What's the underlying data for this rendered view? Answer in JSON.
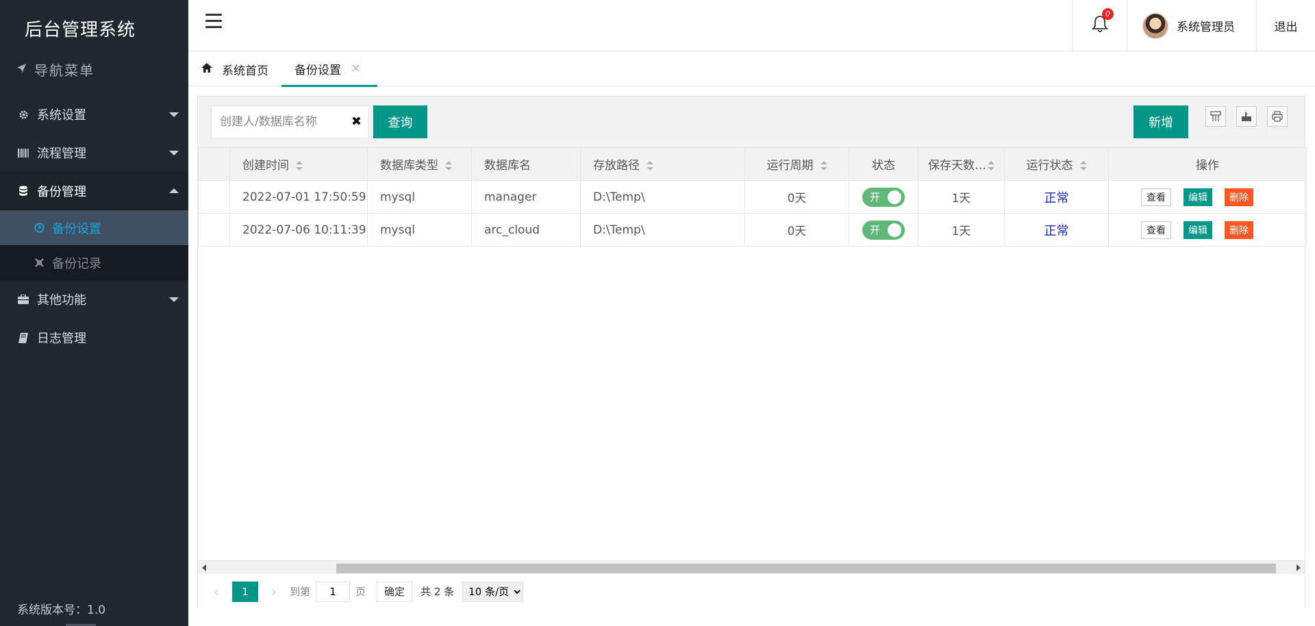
{
  "app": {
    "title": "后台管理系统",
    "nav_menu_label": "导航菜单",
    "version_label": "系统版本号：1.0"
  },
  "sidebar": {
    "items": [
      {
        "label": "系统设置",
        "icon": "gear-icon",
        "expanded": false
      },
      {
        "label": "流程管理",
        "icon": "barcode-icon",
        "expanded": false
      },
      {
        "label": "备份管理",
        "icon": "database-icon",
        "expanded": true,
        "children": [
          {
            "label": "备份设置",
            "icon": "clock-icon",
            "active": true
          },
          {
            "label": "备份记录",
            "icon": "cross-icon",
            "active": false
          }
        ]
      },
      {
        "label": "其他功能",
        "icon": "briefcase-icon",
        "expanded": false
      },
      {
        "label": "日志管理",
        "icon": "book-icon",
        "expanded": false
      }
    ]
  },
  "header": {
    "notification_count": "0",
    "user_name": "系统管理员",
    "logout_label": "退出"
  },
  "tabs": [
    {
      "label": "系统首页",
      "icon": "home-icon"
    },
    {
      "label": "备份设置",
      "active": true
    }
  ],
  "toolbar": {
    "search_placeholder": "创建人/数据库名称",
    "search_value": "",
    "query_label": "查询",
    "add_label": "新增"
  },
  "table": {
    "columns": [
      "创建时间",
      "数据库类型",
      "数据库名",
      "存放路径",
      "运行周期",
      "状态",
      "保存天数…",
      "运行状态",
      "操作"
    ],
    "rows": [
      {
        "created": "2022-07-01 17:50:59",
        "db_type": "mysql",
        "db_name": "manager",
        "path": "D:\\Temp\\",
        "cycle": "0天",
        "switch": "开",
        "keep_days": "1天",
        "run_status": "正常"
      },
      {
        "created": "2022-07-06 10:11:39",
        "db_type": "mysql",
        "db_name": "arc_cloud",
        "path": "D:\\Temp\\",
        "cycle": "0天",
        "switch": "开",
        "keep_days": "1天",
        "run_status": "正常"
      }
    ],
    "op_view": "查看",
    "op_edit": "编辑",
    "op_delete": "删除"
  },
  "pager": {
    "current_page": "1",
    "goto_label": "到第",
    "goto_value": "1",
    "page_unit": "页",
    "confirm_label": "确定",
    "total_label": "共 2 条",
    "page_size": "10 条/页"
  },
  "colors": {
    "primary": "#009688",
    "sidebar_bg": "#20282f",
    "active_sub": "#414f62",
    "accent_text": "#15a3d9",
    "danger": "#ff5722",
    "switch_on": "#5fb878",
    "status_ok": "#1e29c9"
  }
}
